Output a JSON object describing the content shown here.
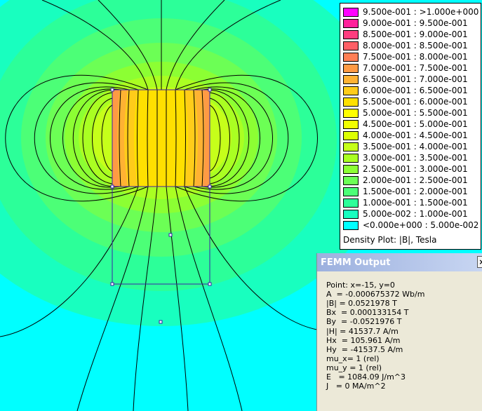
{
  "legend": {
    "entries": [
      {
        "label": "9.500e-001 : >1.000e+000",
        "color": "#ff00ff"
      },
      {
        "label": "9.000e-001 : 9.500e-001",
        "color": "#ff1f9a"
      },
      {
        "label": "8.500e-001 : 9.000e-001",
        "color": "#ff3d7f"
      },
      {
        "label": "8.000e-001 : 8.500e-001",
        "color": "#ff5f66"
      },
      {
        "label": "7.500e-001 : 8.000e-001",
        "color": "#ff7f55"
      },
      {
        "label": "7.000e-001 : 7.500e-001",
        "color": "#ff9a44"
      },
      {
        "label": "6.500e-001 : 7.000e-001",
        "color": "#ffb233"
      },
      {
        "label": "6.000e-001 : 6.500e-001",
        "color": "#ffcc1a"
      },
      {
        "label": "5.500e-001 : 6.000e-001",
        "color": "#ffe000"
      },
      {
        "label": "5.000e-001 : 5.500e-001",
        "color": "#ffff00"
      },
      {
        "label": "4.500e-001 : 5.000e-001",
        "color": "#f2ff00"
      },
      {
        "label": "4.000e-001 : 4.500e-001",
        "color": "#ddff00"
      },
      {
        "label": "3.500e-001 : 4.000e-001",
        "color": "#c6ff1a"
      },
      {
        "label": "3.000e-001 : 3.500e-001",
        "color": "#aaff22"
      },
      {
        "label": "2.500e-001 : 3.000e-001",
        "color": "#8cff33"
      },
      {
        "label": "2.000e-001 : 2.500e-001",
        "color": "#6cff55"
      },
      {
        "label": "1.500e-001 : 2.000e-001",
        "color": "#4cff77"
      },
      {
        "label": "1.000e-001 : 1.500e-001",
        "color": "#2cff99"
      },
      {
        "label": "5.000e-002 : 1.000e-001",
        "color": "#18ffbf"
      },
      {
        "label": "<0.000e+000 : 5.000e-002",
        "color": "#00ffff"
      }
    ],
    "footer": "Density Plot: |B|, Tesla"
  },
  "femm": {
    "title": "FEMM Output",
    "close_label": "×",
    "lines": [
      "Point: x=-15, y=0",
      "A  = -0.000675372 Wb/m",
      "|B| = 0.0521978 T",
      "Bx  = 0.000133154 T",
      "By  = -0.0521976 T",
      "|H| = 41537.7 A/m",
      "Hx  = 105.961 A/m",
      "Hy  = -41537.5 A/m",
      "mu_x= 1 (rel)",
      "mu_y = 1 (rel)",
      "E   = 1084.09 J/m^3",
      "J   = 0 MA/m^2"
    ]
  },
  "colors": {
    "background": "#00ffff",
    "outline": "#3a1fa8",
    "field_lines": "#000000"
  }
}
